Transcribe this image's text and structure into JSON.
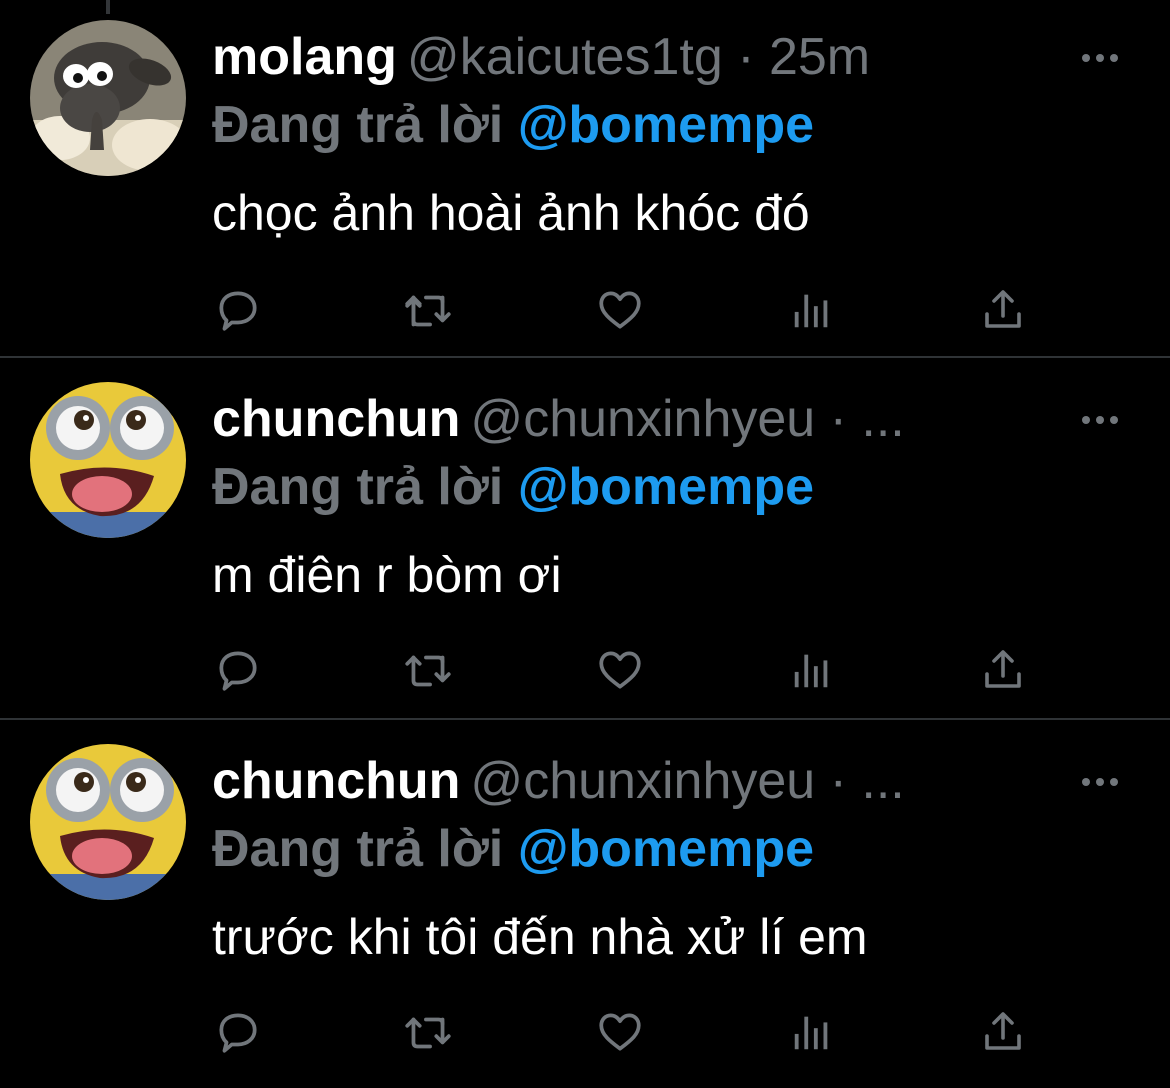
{
  "colors": {
    "background": "#000000",
    "primary_text": "#ffffff",
    "secondary_text": "#71767b",
    "link": "#1d9bf0",
    "divider": "#2f3336"
  },
  "tweets": [
    {
      "display_name": "molang",
      "meta": "@kaicutes1tg · 25m",
      "reply_prefix": "Đang trả lời",
      "reply_handle": "@bomempe",
      "text": "chọc ảnh hoài ảnh khóc đó",
      "avatar_icon": "sheep-avatar"
    },
    {
      "display_name": "chunchun",
      "meta": "@chunxinhyeu · ...",
      "reply_prefix": "Đang trả lời",
      "reply_handle": "@bomempe",
      "text": "m điên r bòm ơi",
      "avatar_icon": "minion-avatar"
    },
    {
      "display_name": "chunchun",
      "meta": "@chunxinhyeu · ...",
      "reply_prefix": "Đang trả lời",
      "reply_handle": "@bomempe",
      "text": "trước khi tôi đến nhà xử lí em",
      "avatar_icon": "minion-avatar"
    }
  ],
  "action_icons": [
    "reply-icon",
    "retweet-icon",
    "like-icon",
    "views-icon",
    "share-icon"
  ]
}
